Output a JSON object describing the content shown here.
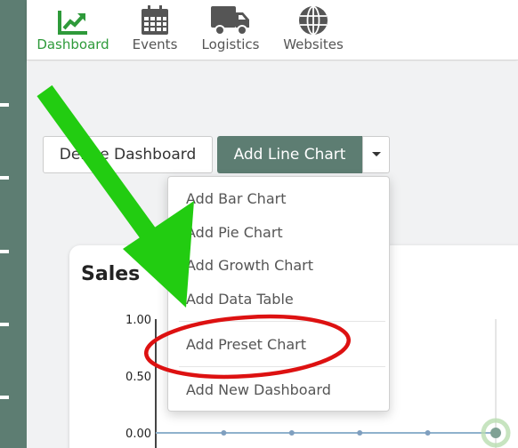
{
  "nav": {
    "items": [
      {
        "label": "Dashboard",
        "icon": "chart-up-icon",
        "active": true
      },
      {
        "label": "Events",
        "icon": "calendar-icon",
        "active": false
      },
      {
        "label": "Logistics",
        "icon": "truck-icon",
        "active": false
      },
      {
        "label": "Websites",
        "icon": "globe-icon",
        "active": false
      }
    ]
  },
  "toolbar": {
    "delete_label": "Delete Dashboard",
    "add_line_label": "Add Line Chart"
  },
  "dropdown": {
    "items": [
      "Add Bar Chart",
      "Add Pie Chart",
      "Add Growth Chart",
      "Add Data Table",
      "Add Preset Chart",
      "Add New Dashboard"
    ]
  },
  "card": {
    "title": "Sales"
  },
  "chart_data": {
    "type": "line",
    "title": "Sales",
    "y_ticks": [
      "1.00",
      "0.50",
      "0.00"
    ],
    "ylim": [
      0,
      1
    ],
    "series": [
      {
        "values": [
          0,
          0,
          0,
          0,
          0,
          0
        ]
      }
    ]
  },
  "colors": {
    "sidebar": "#5d7d72",
    "accent": "#2e9a3a",
    "primary_button": "#5d7d72",
    "annotation_arrow": "#22cc11",
    "annotation_circle": "#dd1111",
    "series_line": "#8fb1cc"
  }
}
